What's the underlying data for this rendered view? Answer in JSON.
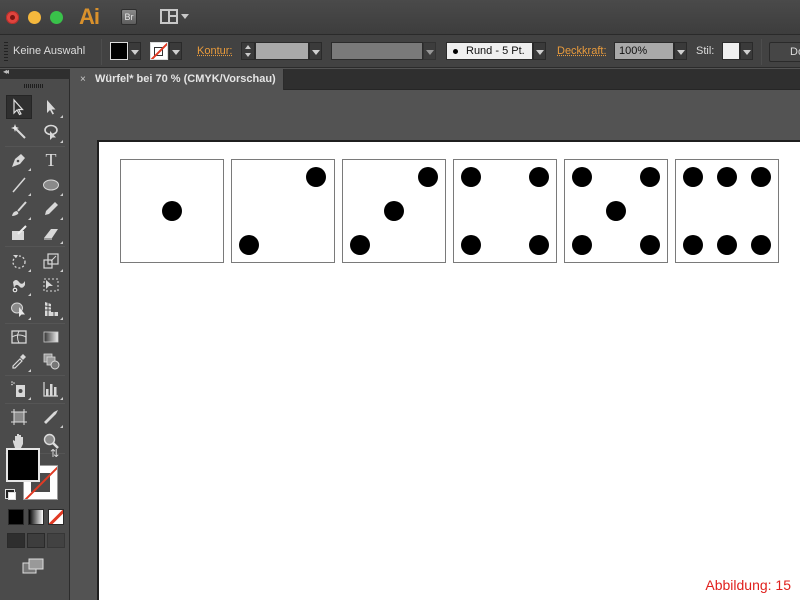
{
  "app": {
    "logo_text": "Ai",
    "bridge_label": "Br",
    "window_controls": [
      "close",
      "minimize",
      "maximize"
    ],
    "workspace_icon": "layout-icon"
  },
  "controlbar": {
    "selection_status": "Keine Auswahl",
    "fill_color": "#000000",
    "stroke_color": "none",
    "stroke_label": "Kontur:",
    "stroke_weight_value": "",
    "variable_width_value": "",
    "brush_label": "Rund - 5 Pt.",
    "opacity_label": "Deckkraft:",
    "opacity_value": "100%",
    "style_label": "Stil:",
    "document_button_label": "Do"
  },
  "document_tab": {
    "close_glyph": "×",
    "title": "Würfel* bei 70 % (CMYK/Vorschau)"
  },
  "tools_panel": {
    "collapse_glyph": "◂◂",
    "tools": [
      {
        "name": "selection-tool",
        "active": true
      },
      {
        "name": "direct-selection-tool"
      },
      {
        "name": "magic-wand-tool"
      },
      {
        "name": "lasso-tool"
      },
      {
        "name": "pen-tool"
      },
      {
        "name": "type-tool",
        "glyph": "T"
      },
      {
        "name": "line-segment-tool"
      },
      {
        "name": "ellipse-tool"
      },
      {
        "name": "paintbrush-tool"
      },
      {
        "name": "pencil-tool"
      },
      {
        "name": "blob-brush-tool"
      },
      {
        "name": "eraser-tool"
      },
      {
        "name": "rotate-tool"
      },
      {
        "name": "scale-tool"
      },
      {
        "name": "puppet-warp-tool"
      },
      {
        "name": "free-transform-tool"
      },
      {
        "name": "shape-builder-tool"
      },
      {
        "name": "perspective-grid-tool"
      },
      {
        "name": "mesh-tool"
      },
      {
        "name": "gradient-tool"
      },
      {
        "name": "eyedropper-tool"
      },
      {
        "name": "blend-tool"
      },
      {
        "name": "symbol-sprayer-tool"
      },
      {
        "name": "column-graph-tool"
      },
      {
        "name": "artboard-tool"
      },
      {
        "name": "slice-tool"
      },
      {
        "name": "hand-tool"
      },
      {
        "name": "zoom-tool"
      }
    ],
    "fill_swatch": "#000000",
    "stroke_swatch": "none",
    "color_modes": [
      "color",
      "gradient",
      "none"
    ],
    "draw_modes": [
      "draw-normal",
      "draw-behind",
      "draw-inside"
    ],
    "screen_mode": "change-screen-mode"
  },
  "artboard": {
    "dice": [
      {
        "value": 1,
        "pips": [
          [
            0.5,
            0.5
          ]
        ]
      },
      {
        "value": 2,
        "pips": [
          [
            0.82,
            0.17
          ],
          [
            0.17,
            0.83
          ]
        ]
      },
      {
        "value": 3,
        "pips": [
          [
            0.83,
            0.17
          ],
          [
            0.5,
            0.5
          ],
          [
            0.17,
            0.83
          ]
        ]
      },
      {
        "value": 4,
        "pips": [
          [
            0.17,
            0.17
          ],
          [
            0.83,
            0.17
          ],
          [
            0.17,
            0.83
          ],
          [
            0.83,
            0.83
          ]
        ]
      },
      {
        "value": 5,
        "pips": [
          [
            0.17,
            0.17
          ],
          [
            0.83,
            0.17
          ],
          [
            0.5,
            0.5
          ],
          [
            0.17,
            0.83
          ],
          [
            0.83,
            0.83
          ]
        ]
      },
      {
        "value": 6,
        "pips": [
          [
            0.17,
            0.17
          ],
          [
            0.5,
            0.17
          ],
          [
            0.83,
            0.17
          ],
          [
            0.17,
            0.83
          ],
          [
            0.5,
            0.83
          ],
          [
            0.83,
            0.83
          ]
        ]
      }
    ]
  },
  "caption": "Abbildung: 15",
  "colors": {
    "accent_orange": "#e99b3c",
    "caption_red": "#e0201d",
    "stroke_none_red": "#e03a24"
  }
}
